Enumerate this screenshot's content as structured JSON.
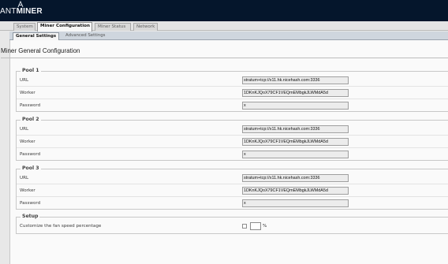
{
  "header": {
    "brand_prefix": "ANT",
    "brand_suffix": "MINER"
  },
  "tabs": [
    {
      "label": "System"
    },
    {
      "label": "Miner Configuration"
    },
    {
      "label": "Miner Status"
    },
    {
      "label": "Network"
    }
  ],
  "active_tab": "Miner Configuration",
  "subtabs": [
    {
      "label": "General Settings"
    },
    {
      "label": "Advanced Settings"
    }
  ],
  "active_subtab": "General Settings",
  "page_title": "Miner General Configuration",
  "pools": [
    {
      "legend": "Pool 1",
      "url_label": "URL",
      "url_value": "stratum+tcp://x11.hk.nicehash.com:3336",
      "worker_label": "Worker",
      "worker_value": "1DKnKJQoX79CF1VEQmEMbgkJLWMdA5d",
      "password_label": "Password",
      "password_value": "x"
    },
    {
      "legend": "Pool 2",
      "url_label": "URL",
      "url_value": "stratum+tcp://x11.hk.nicehash.com:3336",
      "worker_label": "Worker",
      "worker_value": "1DKnKJQoX79CF1VEQmEMbgkJLWMdA5d",
      "password_label": "Password",
      "password_value": "x"
    },
    {
      "legend": "Pool 3",
      "url_label": "URL",
      "url_value": "stratum+tcp://x11.hk.nicehash.com:3336",
      "worker_label": "Worker",
      "worker_value": "1DKnKJQoX79CF1VEQmEMbgkJLWMdA5d",
      "password_label": "Password",
      "password_value": "x"
    }
  ],
  "setup": {
    "legend": "Setup",
    "fan_label": "Customize the fan speed percentage",
    "fan_checked": false,
    "fan_value": "",
    "fan_unit": "%"
  },
  "colors": {
    "header_bg": "#05162c",
    "field_bg": "#ececec",
    "subtab_bar_bg": "#cfd6de"
  },
  "icons": {
    "brand_mark": "ant-logo-icon"
  }
}
